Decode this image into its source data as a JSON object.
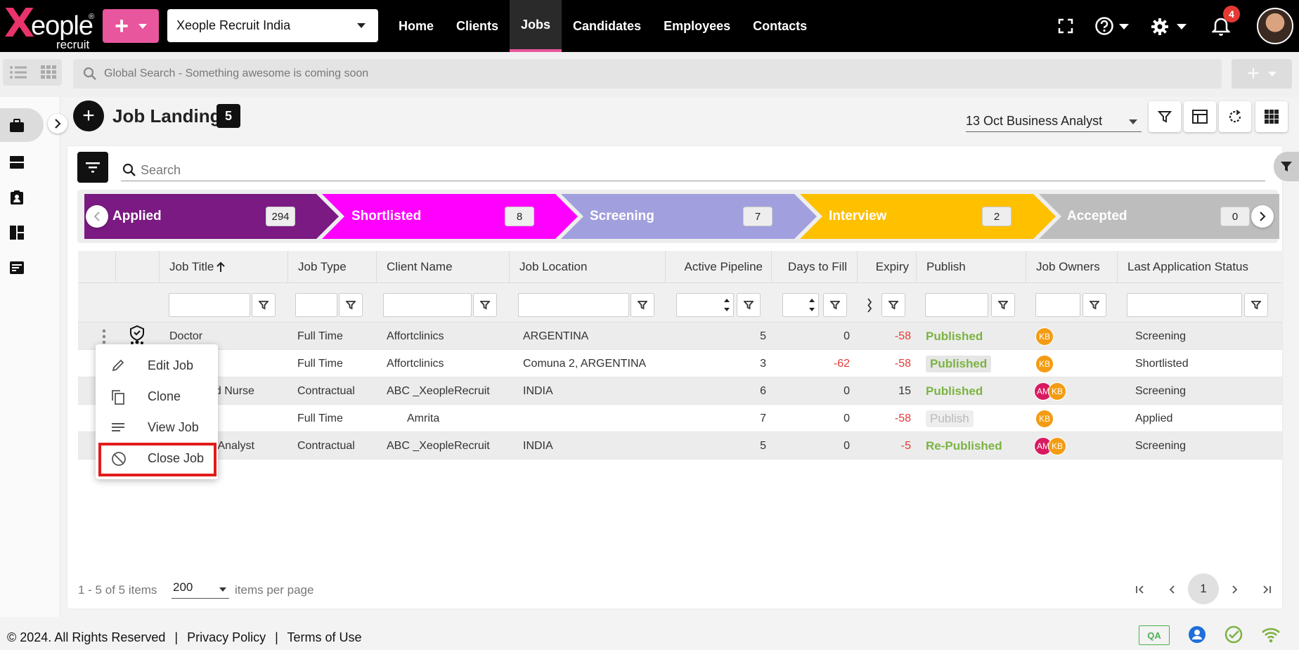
{
  "brand": {
    "logo_main": "eople",
    "logo_sub": "recruit"
  },
  "org_selector": {
    "value": "Xeople Recruit India"
  },
  "nav": {
    "items": [
      "Home",
      "Clients",
      "Jobs",
      "Candidates",
      "Employees",
      "Contacts"
    ],
    "active": "Jobs"
  },
  "notifications": {
    "count": "4"
  },
  "global_search": {
    "placeholder": "Global Search - Something awesome is coming soon"
  },
  "page": {
    "title": "Job Landing",
    "count": "5",
    "saved_view": "13 Oct Business Analyst"
  },
  "list_search": {
    "placeholder": "Search"
  },
  "pipeline": [
    {
      "name": "Applied",
      "count": "294",
      "color": "#7a1a82"
    },
    {
      "name": "Shortlisted",
      "count": "8",
      "color": "#ff00ff"
    },
    {
      "name": "Screening",
      "count": "7",
      "color": "#a19fdd"
    },
    {
      "name": "Interview",
      "count": "2",
      "color": "#ffc000"
    },
    {
      "name": "Accepted",
      "count": "0",
      "color": "#bdbdbd"
    }
  ],
  "grid": {
    "columns": [
      "Job Title",
      "Job Type",
      "Client Name",
      "Job Location",
      "Active Pipeline",
      "Days to Fill",
      "Expiry",
      "Publish",
      "Job Owners",
      "Last Application Status"
    ],
    "rows": [
      {
        "title": "Doctor",
        "type": "Full Time",
        "client": "Affortclinics",
        "location": "ARGENTINA",
        "pipeline": "5",
        "days": "0",
        "expiry": "-58",
        "publish": "Published",
        "owners": [
          "KB"
        ],
        "status": "Screening"
      },
      {
        "title": "",
        "type": "Full Time",
        "client": "Affortclinics",
        "location": "Comuna 2, ARGENTINA",
        "pipeline": "3",
        "days": "-62",
        "expiry": "-58",
        "publish": "Published",
        "owners": [
          "KB"
        ],
        "status": "Shortlisted"
      },
      {
        "title": "ed Nurse",
        "type": "Contractual",
        "client": "ABC _XeopleRecruit",
        "location": "INDIA",
        "pipeline": "6",
        "days": "0",
        "expiry": "15",
        "publish": "Published",
        "owners": [
          "AM",
          "KB"
        ],
        "status": "Screening"
      },
      {
        "title": "",
        "type": "Full Time",
        "client": "Amrita",
        "location": "",
        "pipeline": "7",
        "days": "0",
        "expiry": "-58",
        "publish": "Publish",
        "owners": [
          "KB"
        ],
        "status": "Applied"
      },
      {
        "title": "e Analyst",
        "type": "Contractual",
        "client": "ABC _XeopleRecruit",
        "location": "INDIA",
        "pipeline": "5",
        "days": "0",
        "expiry": "-5",
        "publish": "Re-Published",
        "owners": [
          "AM",
          "KB"
        ],
        "status": "Screening"
      }
    ]
  },
  "context_menu": {
    "items": [
      "Edit Job",
      "Clone",
      "View Job",
      "Close Job"
    ]
  },
  "pager": {
    "info": "1 - 5 of 5 items",
    "page_size": "200",
    "per_page_label": "items per page",
    "current": "1"
  },
  "footer": {
    "copyright": "© 2024. All Rights Reserved",
    "sep": "|",
    "privacy": "Privacy Policy",
    "terms": "Terms of Use",
    "env": "QA"
  },
  "colors": {
    "accent": "#e8569e",
    "published": "#7cb342",
    "negative": "#e53935",
    "highlight": "#e31b1b"
  }
}
